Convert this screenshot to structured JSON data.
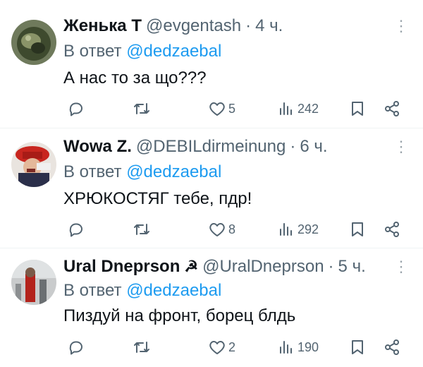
{
  "replies": [
    {
      "name": "Женька Т",
      "badge": "",
      "handle": "@evgentash",
      "separator": "·",
      "time": "4 ч.",
      "reply_prefix": "В ответ",
      "reply_to": "@dedzaebal",
      "text": "А нас то за що???",
      "likes": "5",
      "views": "242"
    },
    {
      "name": "Wowa Z.",
      "badge": "",
      "handle": "@DEBILdirmeinung",
      "separator": "·",
      "time": "6 ч.",
      "reply_prefix": "В ответ",
      "reply_to": "@dedzaebal",
      "text": "ХРЮКОСТЯГ тебе, пдр!",
      "likes": "8",
      "views": "292"
    },
    {
      "name": "Ural Dneprson",
      "badge": "☭",
      "handle": "@UralDneprson",
      "separator": "·",
      "time": "5 ч.",
      "reply_prefix": "В ответ",
      "reply_to": "@dedzaebal",
      "text": "Пиздуй на фронт, борец блдь",
      "likes": "2",
      "views": "190"
    }
  ],
  "icons": {
    "reply": "reply-icon",
    "retweet": "retweet-icon",
    "like": "heart-icon",
    "views": "views-icon",
    "bookmark": "bookmark-icon",
    "share": "share-icon",
    "more": "more-icon"
  },
  "colors": {
    "text": "#0f1419",
    "secondary": "#536471",
    "mention": "#1d9bf0",
    "divider": "#eff3f4"
  }
}
